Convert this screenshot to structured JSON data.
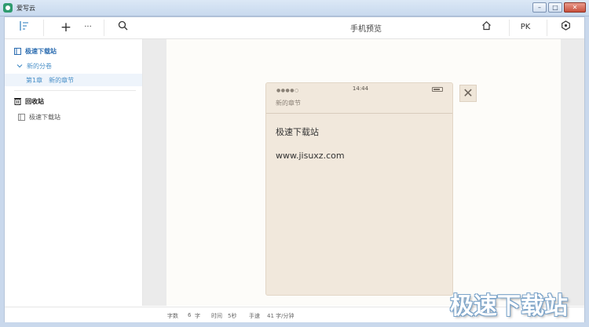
{
  "window": {
    "title": "爱写云",
    "min_glyph": "–",
    "max_glyph": "□",
    "close_glyph": "✕"
  },
  "toolbar": {
    "outline_icon": "outline-icon",
    "add_glyph": "+",
    "more_glyph": "···",
    "search_glyph": "⌕",
    "title": "手机预览",
    "home_glyph": "⌂",
    "pk_label": "PK",
    "settings_glyph": "⊙"
  },
  "sidebar": {
    "book_title": "极速下载站",
    "volume_title": "新的分卷",
    "chapter_number": "第1章",
    "chapter_title": "新的章节",
    "trash_label": "回收站",
    "trash_item": "极速下载站"
  },
  "preview": {
    "status_dots": "●●●●○",
    "time": "14:44",
    "chapter_title": "新的章节",
    "lines": [
      "极速下载站",
      "www.jisuxz.com"
    ],
    "close_glyph": "✕"
  },
  "status": {
    "chars_label": "字数",
    "chars_value": "6",
    "chars_unit": "字",
    "time_label": "时间",
    "time_value": "5秒",
    "speed_label": "手速",
    "speed_value": "41 字/分钟"
  },
  "watermark": "极速下载站",
  "colors": {
    "accent": "#4a90c8",
    "paper": "#f1e8dc"
  }
}
